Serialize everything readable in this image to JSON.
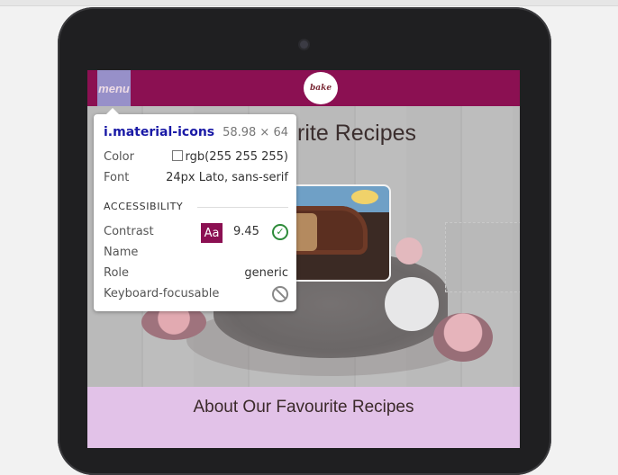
{
  "page": {
    "nav": {
      "menu_label": "menu",
      "logo_text": "bake"
    },
    "hero": {
      "title_partial": "urite Recipes"
    },
    "about": {
      "title": "About Our Favourite Recipes"
    }
  },
  "inspector": {
    "selector": "i.material-icons",
    "dimensions": "58.98 × 64",
    "color_label": "Color",
    "color_value": "rgb(255 255 255)",
    "font_label": "Font",
    "font_value": "24px Lato, sans-serif",
    "accessibility_heading": "ACCESSIBILITY",
    "contrast_label": "Contrast",
    "contrast_badge": "Aa",
    "contrast_value": "9.45",
    "name_label": "Name",
    "role_label": "Role",
    "role_value": "generic",
    "keyboard_label": "Keyboard-focusable"
  },
  "colors": {
    "nav_bg": "#8b1052",
    "about_bg": "#e2c2e8",
    "selector_color": "#1a1aa6",
    "pass_color": "#2e8b3a"
  }
}
